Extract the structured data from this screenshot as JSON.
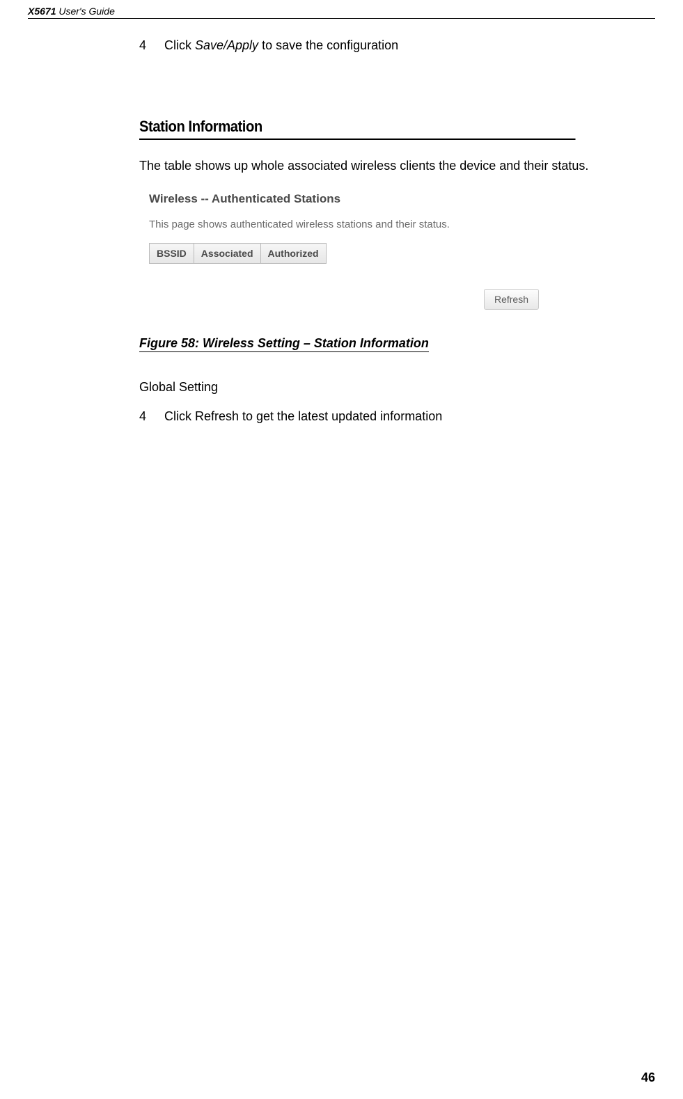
{
  "header": {
    "model": "X5671",
    "suffix": " User's Guide"
  },
  "intro_list": {
    "num": "4",
    "prefix": "Click ",
    "italic": "Save/Apply",
    "suffix": " to save the configuration"
  },
  "section_heading": "Station Information",
  "paragraph": "The table shows up whole associated wireless clients the device and their status.",
  "screenshot": {
    "title": "Wireless -- Authenticated Stations",
    "subtitle": "This page shows authenticated wireless stations and their status.",
    "columns": [
      "BSSID",
      "Associated",
      "Authorized"
    ],
    "refresh_label": "Refresh"
  },
  "figure_caption": "Figure 58: Wireless Setting – Station Information",
  "global_setting_label": "Global Setting",
  "bottom_list": {
    "num": "4",
    "text": "Click Refresh to get the latest updated information"
  },
  "page_number": "46"
}
